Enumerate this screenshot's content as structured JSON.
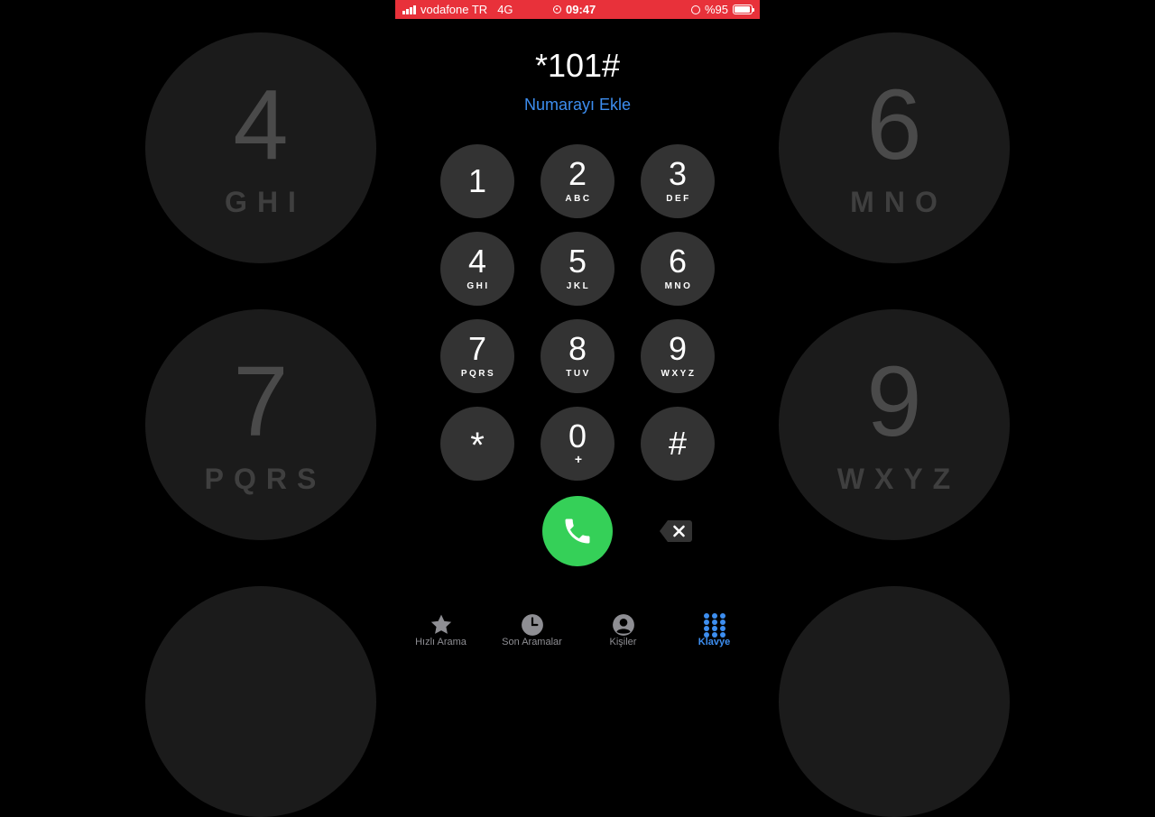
{
  "background_keys": [
    {
      "digit": "4",
      "letters": "GHI"
    },
    {
      "digit": "6",
      "letters": "MNO"
    },
    {
      "digit": "7",
      "letters": "PQRS"
    },
    {
      "digit": "9",
      "letters": "WXYZ"
    }
  ],
  "status_bar": {
    "carrier": "vodafone TR",
    "network": "4G",
    "time": "09:47",
    "battery": "%95",
    "battery_level": 0.95,
    "color": "#e8313a"
  },
  "dialer": {
    "entered_number": "*101#",
    "add_number_label": "Numarayı Ekle",
    "keys": [
      {
        "digit": "1",
        "letters": ""
      },
      {
        "digit": "2",
        "letters": "ABC"
      },
      {
        "digit": "3",
        "letters": "DEF"
      },
      {
        "digit": "4",
        "letters": "GHI"
      },
      {
        "digit": "5",
        "letters": "JKL"
      },
      {
        "digit": "6",
        "letters": "MNO"
      },
      {
        "digit": "7",
        "letters": "PQRS"
      },
      {
        "digit": "8",
        "letters": "TUV"
      },
      {
        "digit": "9",
        "letters": "WXYZ"
      },
      {
        "digit": "*",
        "letters": ""
      },
      {
        "digit": "0",
        "letters": "+"
      },
      {
        "digit": "#",
        "letters": ""
      }
    ],
    "call_color": "#35d058"
  },
  "tabs": [
    {
      "label": "Hızlı Arama",
      "icon": "star-icon"
    },
    {
      "label": "Son Aramalar",
      "icon": "clock-icon"
    },
    {
      "label": "Kişiler",
      "icon": "person-icon"
    },
    {
      "label": "Klavye",
      "icon": "keypad-icon",
      "active": true
    }
  ],
  "accent_color": "#3d8ef0"
}
